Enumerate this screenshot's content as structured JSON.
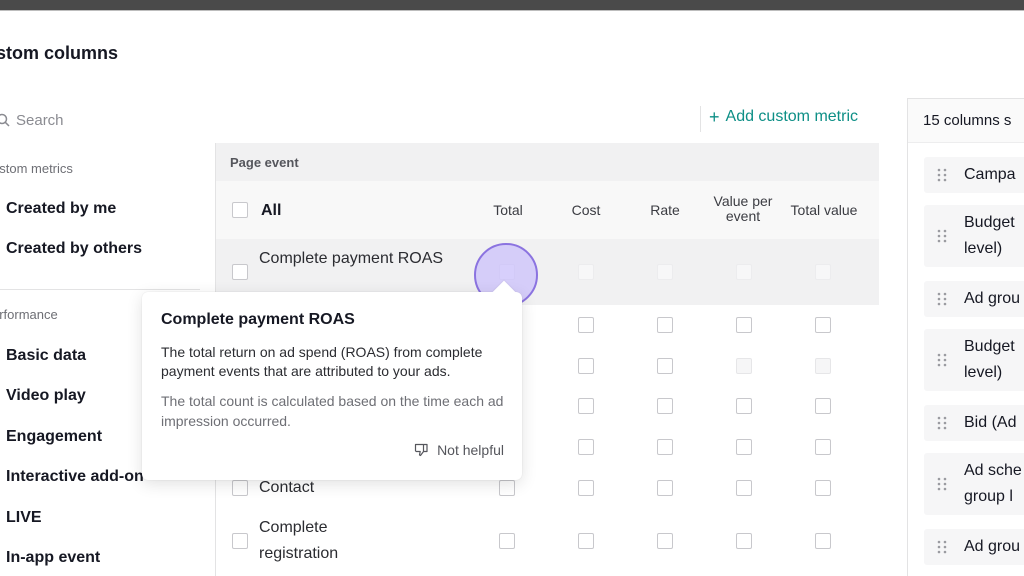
{
  "page": {
    "title": "stom columns"
  },
  "search": {
    "placeholder": "Search",
    "add_metric_label": "Add custom metric"
  },
  "sidebar": {
    "custom_metrics_heading": "ustom metrics",
    "custom_items": [
      "Created by me",
      "Created by others"
    ],
    "performance_heading": "erformance",
    "performance_items": [
      "Basic data",
      "Video play",
      "Engagement",
      "Interactive add-on",
      "LIVE",
      "In-app event"
    ]
  },
  "table": {
    "group_header": "Page event",
    "all_label": "All",
    "columns": [
      "Total",
      "Cost",
      "Rate",
      "Value per event",
      "Total value"
    ],
    "rows": [
      {
        "label": "Complete payment ROAS"
      },
      {
        "label": ""
      },
      {
        "label": ""
      },
      {
        "label": ""
      },
      {
        "label": ""
      },
      {
        "label": "Contact"
      },
      {
        "label": "Complete registration"
      }
    ]
  },
  "right_panel": {
    "title": "15 columns s",
    "items": [
      "Campa",
      "Budget level)",
      "Ad grou",
      "Budget level)",
      "Bid (Ad",
      "Ad sche group l",
      "Ad grou"
    ]
  },
  "tooltip": {
    "title": "Complete payment ROAS",
    "description": "The total return on ad spend (ROAS) from complete payment events that are attributed to your ads.",
    "note": "The total count is calculated based on the time each ad impression occurred.",
    "feedback_label": "Not helpful"
  },
  "colors": {
    "accent": "#0d8f86",
    "focus_ring": "#8b73e0"
  }
}
